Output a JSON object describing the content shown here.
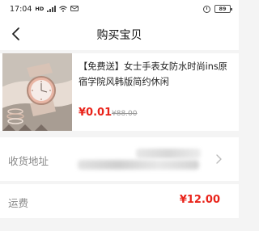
{
  "status_bar": {
    "time": "17:04",
    "signal_label": "HD",
    "battery": "89"
  },
  "nav": {
    "title": "购买宝贝",
    "back_icon": "chevron-left-icon"
  },
  "product": {
    "title": "【免费送】女士手表女防水时尚ins原宿学院风韩版简约休闲",
    "price": "¥0.01",
    "original_price": "¥88.00"
  },
  "address": {
    "label": "收货地址",
    "chevron_icon": "chevron-right-icon"
  },
  "shipping": {
    "label": "运费",
    "fee": "¥12.00"
  },
  "colors": {
    "price_red": "#e9231a",
    "label_gray": "#888888",
    "background": "#f4f4f4"
  }
}
